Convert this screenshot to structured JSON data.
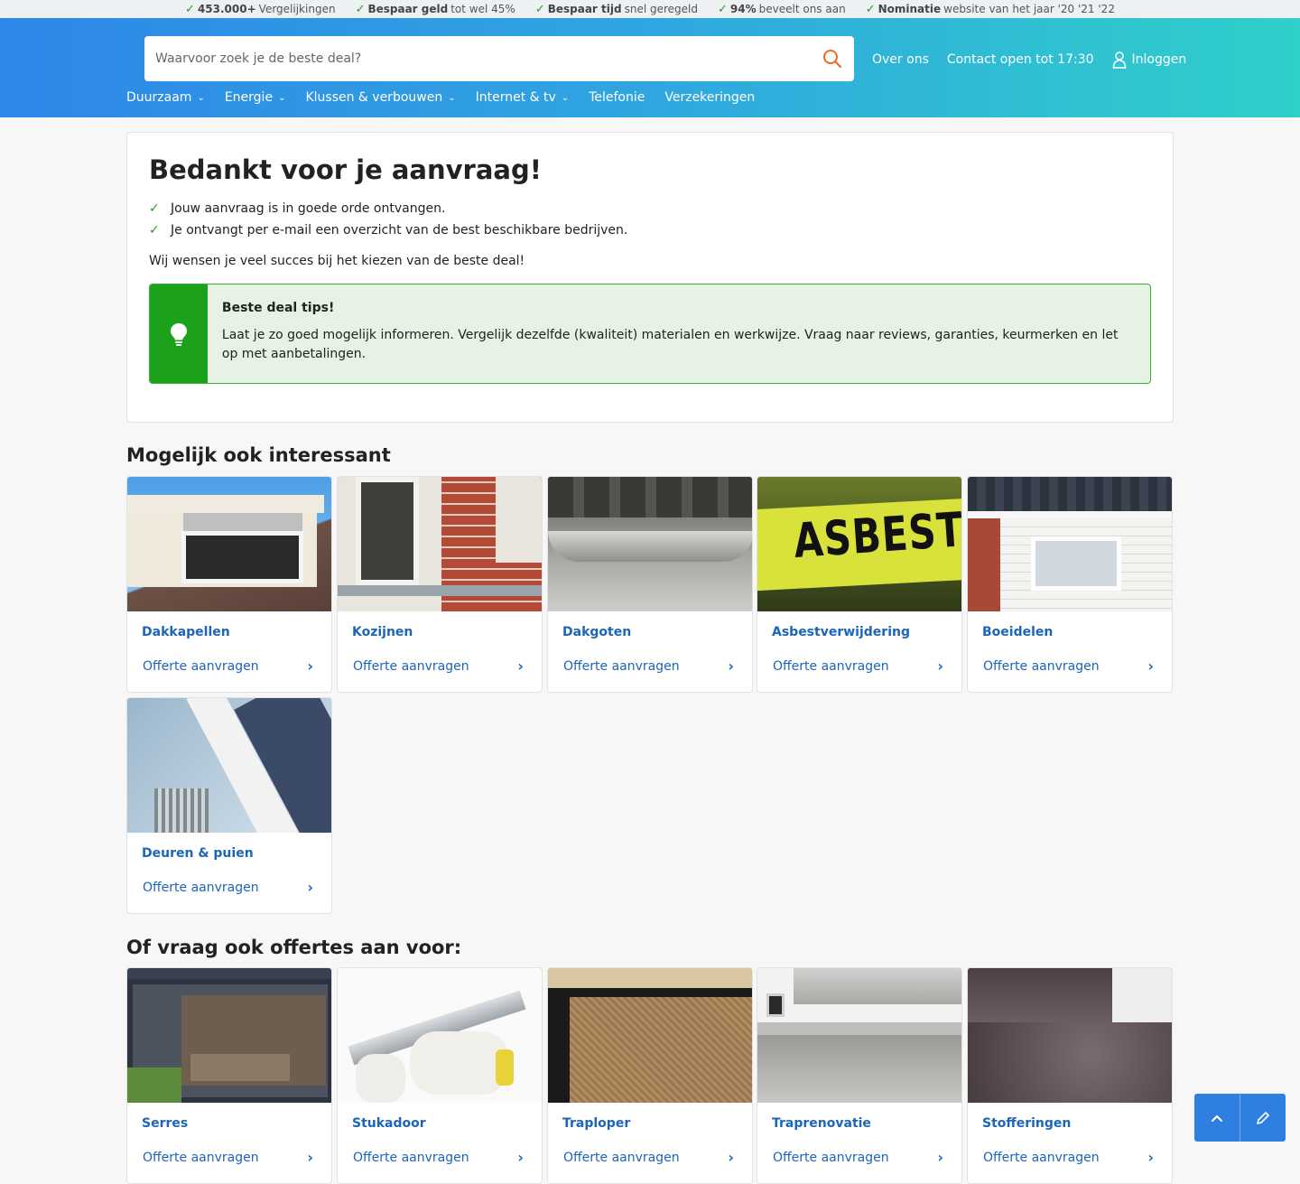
{
  "usps": [
    {
      "bold": "453.000+",
      "text": "Vergelijkingen"
    },
    {
      "bold": "Bespaar geld",
      "text": "tot wel 45%"
    },
    {
      "bold": "Bespaar tijd",
      "text": "snel geregeld"
    },
    {
      "bold": "94%",
      "text": "beveelt ons aan"
    },
    {
      "bold": "Nominatie",
      "text": "website van het jaar '20 '21 '22"
    }
  ],
  "search": {
    "placeholder": "Waarvoor zoek je de beste deal?"
  },
  "header_links": {
    "about": "Over ons",
    "contact": "Contact open tot 17:30",
    "login": "Inloggen"
  },
  "nav": [
    "Duurzaam",
    "Energie",
    "Klussen & verbouwen",
    "Internet & tv",
    "Telefonie",
    "Verzekeringen"
  ],
  "confirmation": {
    "title": "Bedankt voor je aanvraag!",
    "checks": [
      "Jouw aanvraag is in goede orde ontvangen.",
      "Je ontvangt per e-mail een overzicht van de best beschikbare bedrijven."
    ],
    "wish": "Wij wensen je veel succes bij het kiezen van de beste deal!",
    "tip_title": "Beste deal tips!",
    "tip_text": "Laat je zo goed mogelijk informeren. Vergelijk dezelfde (kwaliteit) materialen en werkwijze. Vraag naar reviews, garanties, keurmerken en let op met aanbetalingen."
  },
  "section1_title": "Mogelijk ook interessant",
  "section2_title": "Of vraag ook offertes aan voor:",
  "cta_label": "Offerte aanvragen",
  "tiles1": [
    "Dakkapellen",
    "Kozijnen",
    "Dakgoten",
    "Asbestverwijdering",
    "Boeidelen",
    "Deuren & puien"
  ],
  "tiles2": [
    "Serres",
    "Stukadoor",
    "Traploper",
    "Traprenovatie",
    "Stofferingen"
  ],
  "asbest_label": "ASBEST",
  "colors": {
    "brand_blue": "#1c65b8",
    "green": "#1ba11a",
    "header_start": "#2e87e8",
    "header_end": "#2fd0c9"
  }
}
